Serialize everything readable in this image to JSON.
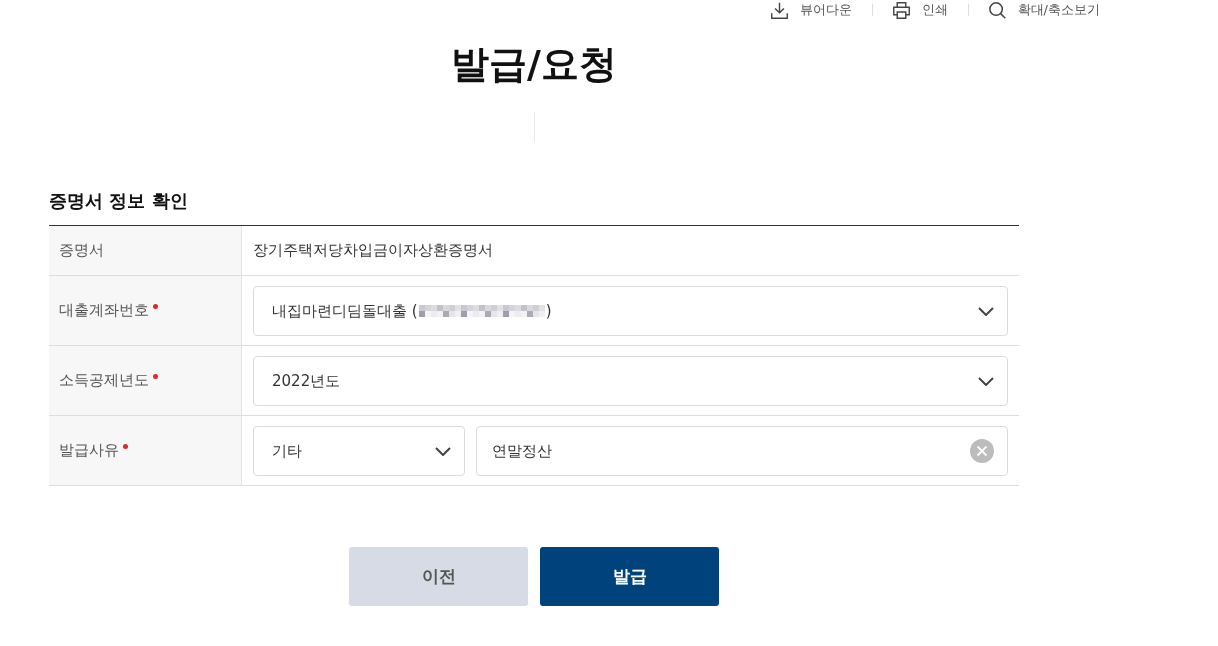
{
  "toolbar": [
    {
      "kind": "download",
      "label": "뷰어다운"
    },
    {
      "kind": "print",
      "label": "인쇄"
    },
    {
      "kind": "zoom",
      "label": "확대/축소보기"
    }
  ],
  "page_title": "발급/요청",
  "section": {
    "title": "증명서 정보 확인",
    "rows": [
      {
        "label": "증명서",
        "required": false,
        "fields": [
          {
            "kind": "text",
            "value": "장기주택저당차입금이자상환증명서"
          }
        ]
      },
      {
        "label": "대출계좌번호",
        "required": true,
        "fields": [
          {
            "kind": "select",
            "value": "내집마련디딤돌대출 (",
            "redacted": true,
            "value_end": ")"
          }
        ]
      },
      {
        "label": "소득공제년도",
        "required": true,
        "fields": [
          {
            "kind": "select",
            "value": "2022년도"
          }
        ]
      },
      {
        "label": "발급사유",
        "required": true,
        "fields": [
          {
            "kind": "select",
            "value": "기타"
          },
          {
            "kind": "input",
            "value": "연말정산",
            "clearable": true
          }
        ]
      }
    ]
  },
  "buttons": [
    {
      "kind": "secondary",
      "label": "이전"
    },
    {
      "kind": "primary",
      "label": "발급"
    }
  ]
}
